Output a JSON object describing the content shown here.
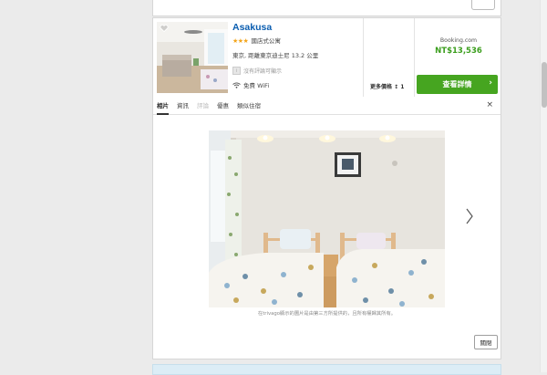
{
  "hotel": {
    "name": "Asakusa",
    "star_rating": 3,
    "stars_glyph": "★★★",
    "type": "國店式公寓",
    "location": "東京, 距離東京迪士尼 13.2 公里",
    "review_status": "沒有評論可顯示",
    "review_icon": "i",
    "amenity": "免費 WiFi"
  },
  "more_prices": "更多價格 ↕ 1",
  "deal": {
    "provider": "Booking.com",
    "price": "NT$13,536",
    "button_label": "查看詳情",
    "button_arrow": "›",
    "accent_color": "#46a520",
    "price_color": "#3b9e1d"
  },
  "tabs": [
    {
      "label": "相片",
      "state": "active"
    },
    {
      "label": "資訊",
      "state": "normal"
    },
    {
      "label": "評論",
      "state": "disabled"
    },
    {
      "label": "優惠",
      "state": "normal"
    },
    {
      "label": "類似住宿",
      "state": "normal"
    }
  ],
  "tabs_close": "×",
  "gallery": {
    "caption": "在trivago顯示的圖片是由第三方所提供的，且所有權歸其所有。",
    "close_label": "關閉"
  },
  "icons": {
    "favorite": "heart-icon",
    "wifi": "wifi-icon",
    "next": "chevron-right-icon",
    "close": "close-icon"
  }
}
